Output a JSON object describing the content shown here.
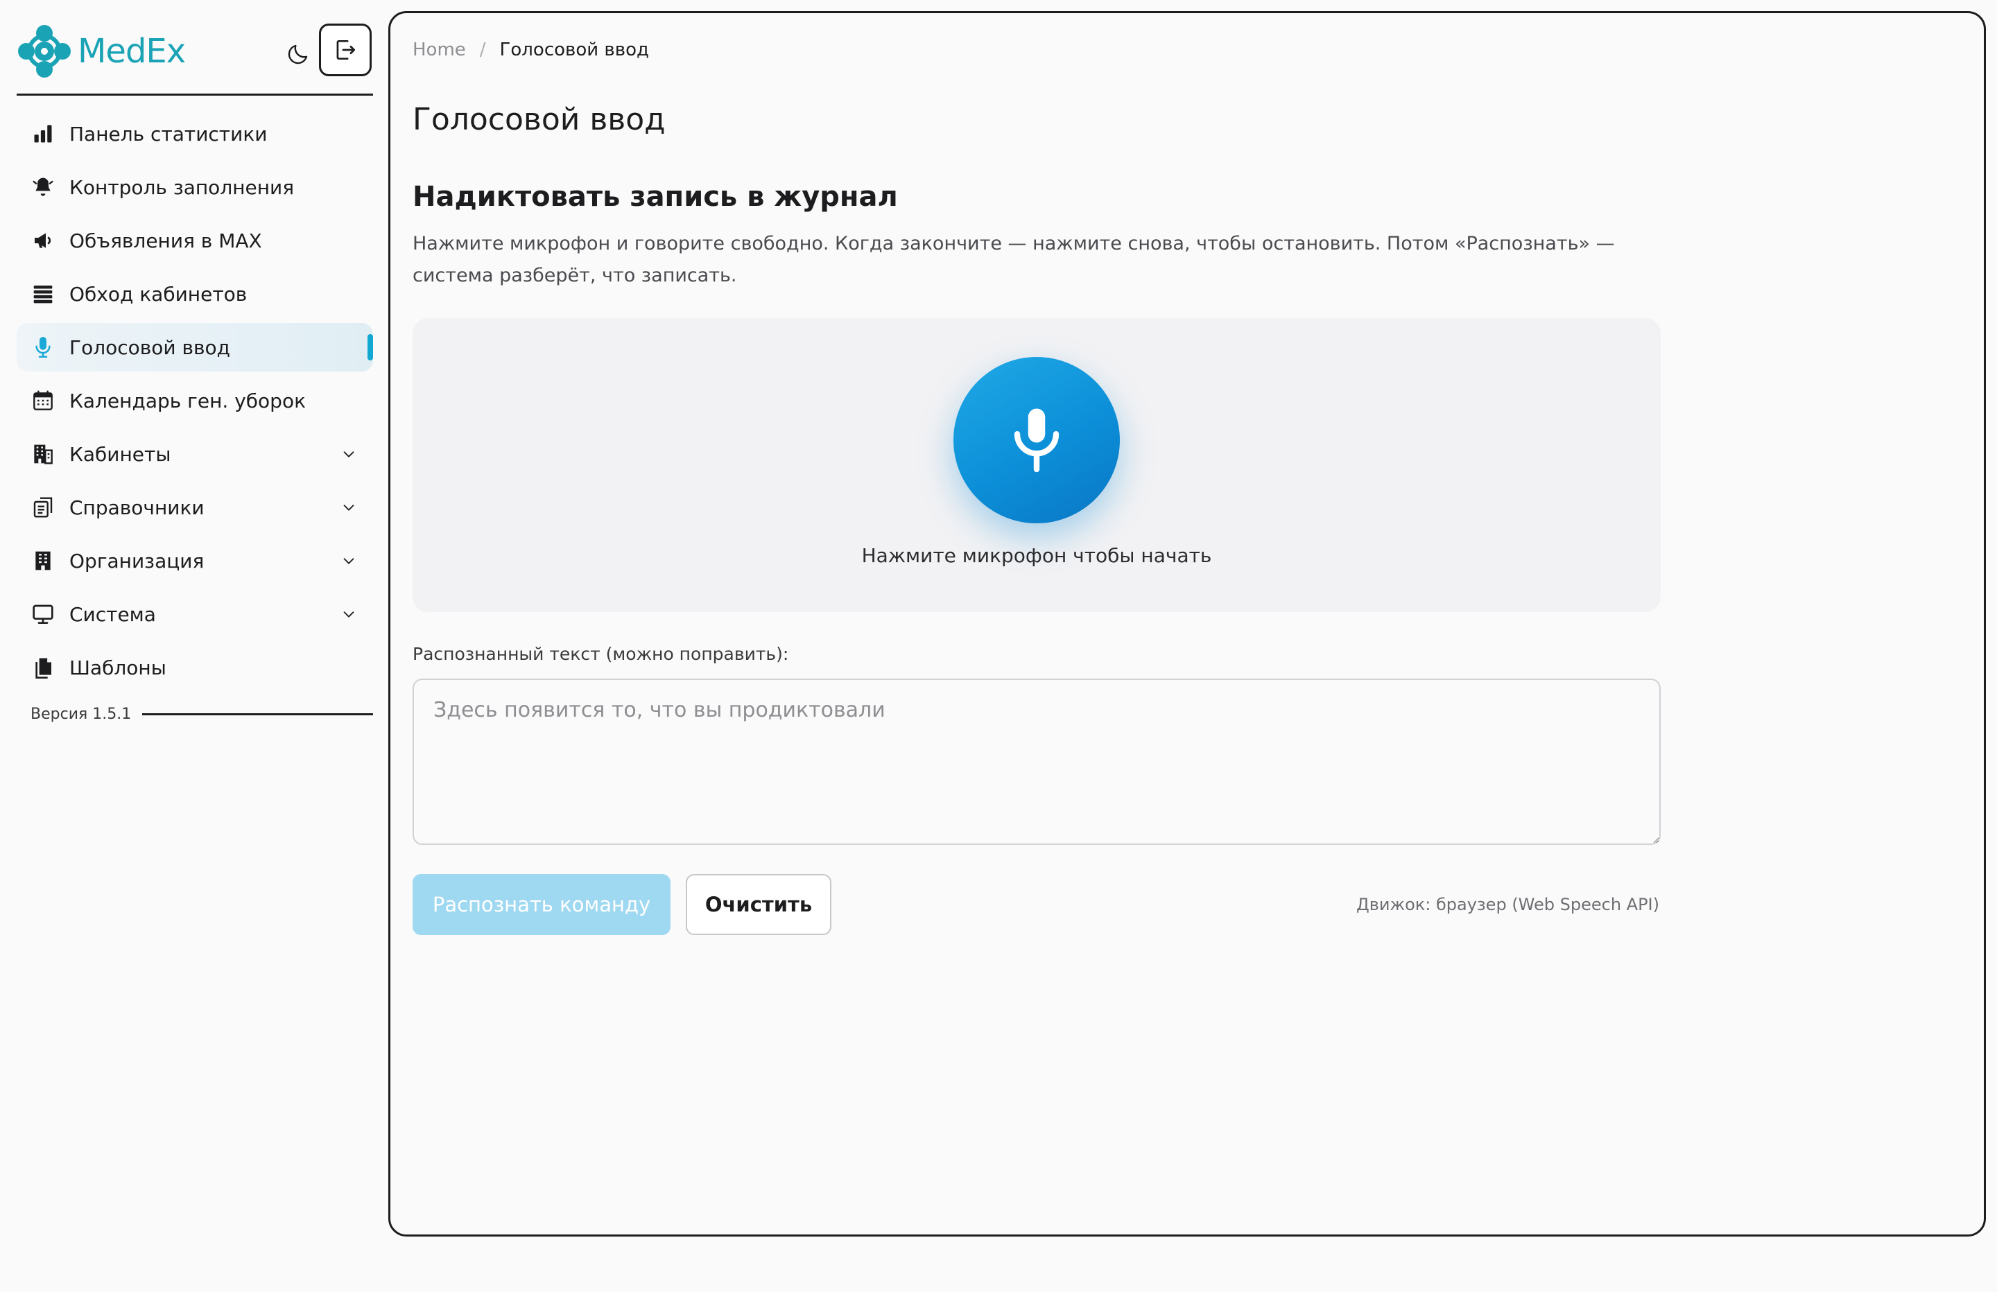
{
  "app": {
    "name": "MedEx",
    "brand_color": "#1aa3b5",
    "accent_color": "#13a8d2"
  },
  "header": {
    "theme_toggle_icon": "moon-icon",
    "logout_icon": "logout-icon"
  },
  "sidebar": {
    "items": [
      {
        "label": "Панель статистики",
        "icon": "bar-chart-icon",
        "active": false,
        "expandable": false
      },
      {
        "label": "Контроль заполнения",
        "icon": "bell-icon",
        "active": false,
        "expandable": false
      },
      {
        "label": "Объявления в MAX",
        "icon": "megaphone-icon",
        "active": false,
        "expandable": false
      },
      {
        "label": "Обход кабинетов",
        "icon": "list-icon",
        "active": false,
        "expandable": false
      },
      {
        "label": "Голосовой ввод",
        "icon": "microphone-icon",
        "active": true,
        "expandable": false
      },
      {
        "label": "Календарь ген. уборок",
        "icon": "calendar-icon",
        "active": false,
        "expandable": false
      },
      {
        "label": "Кабинеты",
        "icon": "building-icon",
        "active": false,
        "expandable": true
      },
      {
        "label": "Справочники",
        "icon": "book-icon",
        "active": false,
        "expandable": true
      },
      {
        "label": "Организация",
        "icon": "office-icon",
        "active": false,
        "expandable": true
      },
      {
        "label": "Система",
        "icon": "monitor-icon",
        "active": false,
        "expandable": true
      },
      {
        "label": "Шаблоны",
        "icon": "documents-icon",
        "active": false,
        "expandable": false
      }
    ],
    "version": "Версия 1.5.1"
  },
  "breadcrumb": {
    "home": "Home",
    "separator": "/",
    "current": "Голосовой ввод"
  },
  "main": {
    "page_title": "Голосовой ввод",
    "section_title": "Надиктовать запись в журнал",
    "section_description": "Нажмите микрофон и говорите свободно. Когда закончите — нажмите снова, чтобы остановить. Потом «Распознать» — система разберёт, что записать.",
    "mic_hint": "Нажмите микрофон чтобы начать",
    "transcript_label": "Распознанный текст (можно поправить):",
    "transcript_value": "",
    "transcript_placeholder": "Здесь появится то, что вы продиктовали",
    "recognize_button": "Распознать команду",
    "recognize_disabled": true,
    "clear_button": "Очистить",
    "engine_info": "Движок: браузер (Web Speech API)"
  }
}
